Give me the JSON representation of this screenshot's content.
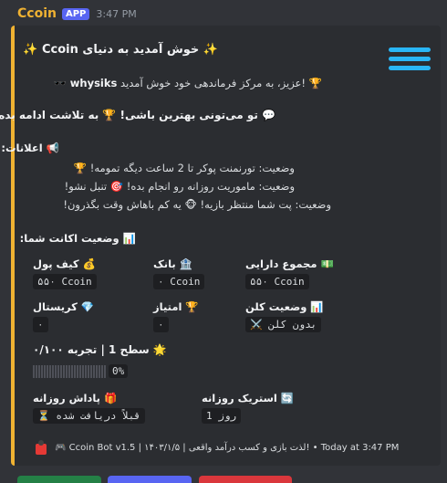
{
  "message": {
    "bot_name": "Ccoin",
    "app_badge": "APP",
    "time": "3:47 PM"
  },
  "embed": {
    "title": "✨ خوش آمدید به دنیای Ccoin ✨",
    "description": {
      "greeting": "🏆 !عزیز، به مرکز فرماندهی خود خوش آمدید",
      "username": "whysiks",
      "motivation": "💬 تو می‌تونی بهترین باشی! 🏆 به تلاشت ادامه بده!",
      "announcements_title": "📢 اعلانات:",
      "status_lines": [
        "وضعیت: تورنمنت پوکر تا 2 ساعت دیگه تمومه! 🏆",
        "وضعیت: ماموریت روزانه رو انجام بده! 🎯 تنبل نشو!",
        "وضعیت: پت شما منتظر بازیه! 🐵 یه کم باهاش وقت بگذرون!"
      ],
      "account_status_title": "📊 وضعیت اکانت شما:"
    },
    "fields": {
      "wallet": {
        "name": "💰 کیف پول",
        "value": "۵۵۰ Ccoin",
        "icon": "money-bag-icon"
      },
      "bank": {
        "name": "🏦 بانک",
        "value": "۰ Ccoin",
        "icon": "bank-icon"
      },
      "total_assets": {
        "name": "💵 مجموع دارایی",
        "value": "۵۵۰ Ccoin",
        "icon": "cash-icon"
      },
      "crystal": {
        "name": "💎 کریستال",
        "value": "۰",
        "icon": "gem-icon"
      },
      "points": {
        "name": "🏆 امتیاز",
        "value": "۰",
        "icon": "trophy-icon"
      },
      "clan": {
        "name": "📊 وضعیت کلن",
        "value": "⚔️ بدون کلن",
        "icon": "chart-icon"
      },
      "daily_reward": {
        "name": "🎁 پاداش روزانه",
        "value": "⏳ قبلاً دریافت شده",
        "icon": "gift-icon"
      },
      "daily_streak": {
        "name": "🔄 استریک روزانه",
        "value": "1 روز",
        "icon": "repeat-icon"
      }
    },
    "level": {
      "text": "🌟 سطح 1 | تجربه ۰/۱۰۰",
      "progress_percent": 0,
      "progress_label": "0%"
    },
    "footer": {
      "text": "🎮 Ccoin Bot v1.5 | ۱۴۰۳/۱/۵ | لذت بازی و کسب درآمد واقعی! • Today at 3:47 PM"
    }
  },
  "colors": {
    "accent": "#f0b232",
    "bot_name": "#f0b232",
    "app_badge": "#5865f2",
    "thumbnail": "#29b6f6",
    "bottom_buttons": [
      "#248046",
      "#5865f2",
      "#da373c"
    ]
  }
}
